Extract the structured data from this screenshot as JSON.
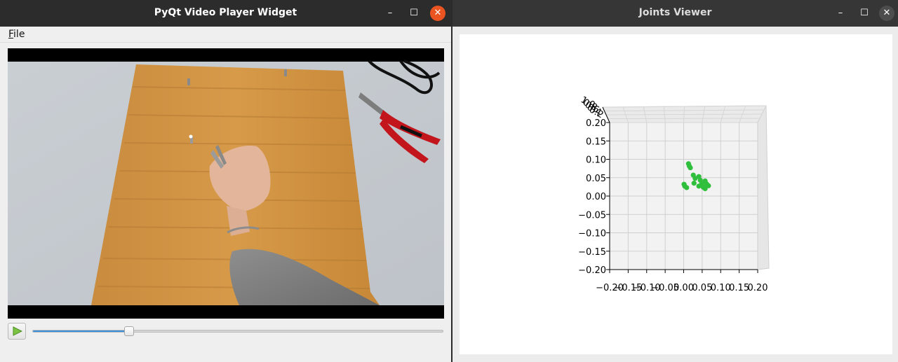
{
  "video_window": {
    "title": "PyQt Video Player Widget",
    "menu": {
      "file_label": "File",
      "file_underline": "F",
      "file_rest": "ile"
    },
    "controls": {
      "play_icon": "play-icon",
      "progress_fraction": 0.235
    }
  },
  "joints_window": {
    "title": "Joints Viewer"
  },
  "titlebar_icons": {
    "minimize": "–",
    "maximize": "☐",
    "close": "✕"
  },
  "colors": {
    "close_active": "#e95420",
    "slider_fill": "#3b8fd9",
    "joint_points": "#2fbf3c"
  },
  "chart_data": {
    "type": "scatter",
    "projection": "3d",
    "title": "",
    "x_ticks": [
      "−0.20",
      "−0.15",
      "−0.10",
      "−0.05",
      "0.00",
      "0.05",
      "0.10",
      "0.15",
      "0.20"
    ],
    "y_ticks": [
      "0.20",
      "0.15",
      "0.10",
      "0.05",
      "0.00",
      "−0.05",
      "−0.10",
      "−0.15",
      "−0.20"
    ],
    "z_ticks": [
      "1.0",
      "0.8",
      "0.6",
      "0.4",
      "0.2"
    ],
    "xlim": [
      -0.2,
      0.2
    ],
    "ylim": [
      -0.2,
      0.2
    ],
    "grid": true,
    "series": [
      {
        "color": "#2fbf3c",
        "points": [
          {
            "x": 0.013,
            "y": 0.088
          },
          {
            "x": 0.015,
            "y": 0.082
          },
          {
            "x": 0.018,
            "y": 0.077
          },
          {
            "x": 0.026,
            "y": 0.057
          },
          {
            "x": 0.031,
            "y": 0.048
          },
          {
            "x": 0.028,
            "y": 0.035
          },
          {
            "x": 0.041,
            "y": 0.053
          },
          {
            "x": 0.045,
            "y": 0.043
          },
          {
            "x": 0.049,
            "y": 0.033
          },
          {
            "x": 0.041,
            "y": 0.027
          },
          {
            "x": 0.058,
            "y": 0.041
          },
          {
            "x": 0.062,
            "y": 0.033
          },
          {
            "x": 0.053,
            "y": 0.024
          },
          {
            "x": 0.067,
            "y": 0.028
          },
          {
            "x": 0.058,
            "y": 0.02
          },
          {
            "x": 0.001,
            "y": 0.032
          },
          {
            "x": 0.003,
            "y": 0.027
          },
          {
            "x": 0.008,
            "y": 0.023
          }
        ]
      }
    ]
  }
}
